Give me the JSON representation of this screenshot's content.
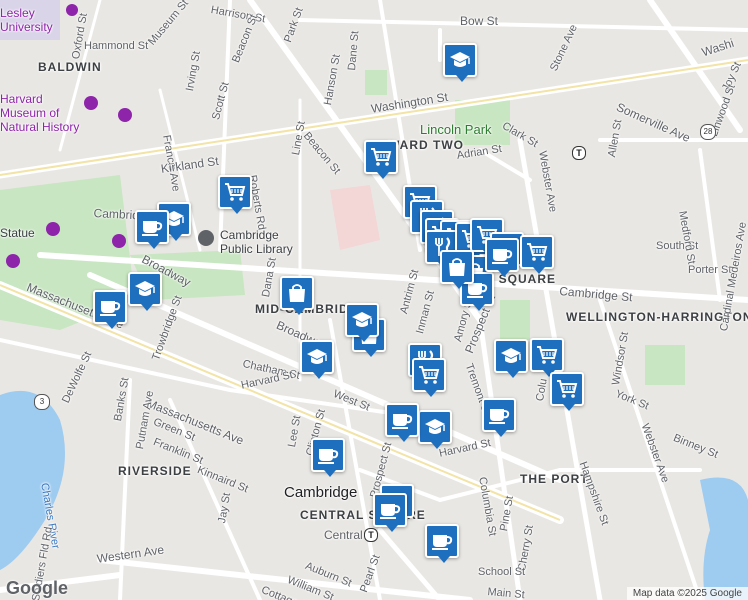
{
  "map": {
    "area_labels": [
      {
        "id": "baldwin",
        "text": "BALDWIN"
      },
      {
        "id": "ward-two",
        "text": "WARD TWO"
      },
      {
        "id": "mid-cambridge",
        "text": "MID-CAMBRIDGE"
      },
      {
        "id": "wellington-harrington",
        "text": "WELLINGTON-HARRINGTON"
      },
      {
        "id": "riverside",
        "text": "RIVERSIDE"
      },
      {
        "id": "the-port",
        "text": "THE PORT"
      },
      {
        "id": "central-square",
        "text": "CENTRAL SQUARE"
      },
      {
        "id": "inman-square",
        "text": "INMAN SQUARE"
      }
    ],
    "city_label": "Cambridge",
    "park_labels": [
      {
        "id": "lincoln-park",
        "text": "Lincoln Park"
      }
    ],
    "poi_labels": [
      {
        "id": "museum",
        "text": "Harvard Museum of Natural History"
      },
      {
        "id": "library",
        "text": "Cambridge Public Library"
      },
      {
        "id": "statue",
        "text": "Statue"
      },
      {
        "id": "university",
        "text": "Lesley University"
      }
    ],
    "water_labels": [
      {
        "id": "charles",
        "text": "Charles River"
      }
    ],
    "street_labels": [
      {
        "id": "bow",
        "text": "Bow St"
      },
      {
        "id": "washington-top",
        "text": "Washington St"
      },
      {
        "id": "washington-right",
        "text": "Washi"
      },
      {
        "id": "stone",
        "text": "Stone Ave"
      },
      {
        "id": "joy",
        "text": "Joy St"
      },
      {
        "id": "linwood",
        "text": "Linwood St"
      },
      {
        "id": "somerville",
        "text": "Somerville Ave"
      },
      {
        "id": "clark",
        "text": "Clark St"
      },
      {
        "id": "adrian",
        "text": "Adrian St"
      },
      {
        "id": "allen",
        "text": "Allen St"
      },
      {
        "id": "webster-top",
        "text": "Webster Ave"
      },
      {
        "id": "webster-bottom",
        "text": "Webster Ave"
      },
      {
        "id": "hammond",
        "text": "Hammond St"
      },
      {
        "id": "museum-st",
        "text": "Museum St"
      },
      {
        "id": "oxford",
        "text": "Oxford St"
      },
      {
        "id": "harrison",
        "text": "Harrison St"
      },
      {
        "id": "park",
        "text": "Park St"
      },
      {
        "id": "beacon-top",
        "text": "Beacon St"
      },
      {
        "id": "beacon-mid",
        "text": "Beacon St"
      },
      {
        "id": "dane",
        "text": "Dane St"
      },
      {
        "id": "hanson",
        "text": "Hanson St"
      },
      {
        "id": "irving",
        "text": "Irving St"
      },
      {
        "id": "scott",
        "text": "Scott St"
      },
      {
        "id": "francis",
        "text": "Francis Ave"
      },
      {
        "id": "kirkland",
        "text": "Kirkland St"
      },
      {
        "id": "line",
        "text": "Line St"
      },
      {
        "id": "roberts",
        "text": "Roberts Rd"
      },
      {
        "id": "cambridge-left",
        "text": "Cambridge St"
      },
      {
        "id": "cambridge-right",
        "text": "Cambridge St"
      },
      {
        "id": "south",
        "text": "South St"
      },
      {
        "id": "porter",
        "text": "Porter St"
      },
      {
        "id": "medford",
        "text": "Medford St"
      },
      {
        "id": "cardinal",
        "text": "Cardinal Medeiros Ave"
      },
      {
        "id": "broadway",
        "text": "Broadway"
      },
      {
        "id": "broadway-mid",
        "text": "Broadway"
      },
      {
        "id": "massachusetts-left",
        "text": "Massachusetts Ave"
      },
      {
        "id": "massachusetts-mid",
        "text": "Massachusetts Ave"
      },
      {
        "id": "dana",
        "text": "Dana St"
      },
      {
        "id": "antrim",
        "text": "Antrim St"
      },
      {
        "id": "inman",
        "text": "Inman St"
      },
      {
        "id": "amory",
        "text": "Amory St"
      },
      {
        "id": "prospect-top",
        "text": "Prospect St"
      },
      {
        "id": "prospect-bottom",
        "text": "Prospect St"
      },
      {
        "id": "chatham",
        "text": "Chatham St"
      },
      {
        "id": "harvard-left",
        "text": "Harvard St"
      },
      {
        "id": "harvard-right",
        "text": "Harvard St"
      },
      {
        "id": "west",
        "text": "West St"
      },
      {
        "id": "trowbridge",
        "text": "Trowbridge St"
      },
      {
        "id": "dewolfe",
        "text": "DeWolfe St"
      },
      {
        "id": "banks",
        "text": "Banks St"
      },
      {
        "id": "putnam",
        "text": "Putnam Ave"
      },
      {
        "id": "green",
        "text": "Green St"
      },
      {
        "id": "franklin",
        "text": "Franklin St"
      },
      {
        "id": "kinnaird",
        "text": "Kinnaird St"
      },
      {
        "id": "jay",
        "text": "Jay St"
      },
      {
        "id": "lee",
        "text": "Lee St"
      },
      {
        "id": "clinton",
        "text": "Clinton St"
      },
      {
        "id": "columbia",
        "text": "Columbia St"
      },
      {
        "id": "pine",
        "text": "Pine St"
      },
      {
        "id": "cherry",
        "text": "Cherry St"
      },
      {
        "id": "school",
        "text": "School St"
      },
      {
        "id": "main",
        "text": "Main St"
      },
      {
        "id": "western",
        "text": "Western Ave"
      },
      {
        "id": "auburn",
        "text": "Auburn St"
      },
      {
        "id": "william",
        "text": "William St"
      },
      {
        "id": "cottage",
        "text": "Cottage St"
      },
      {
        "id": "pearl",
        "text": "Pearl St"
      },
      {
        "id": "soldiers",
        "text": "Soldiers Fld Rd"
      },
      {
        "id": "york",
        "text": "York St"
      },
      {
        "id": "binney",
        "text": "Binney St"
      },
      {
        "id": "windsor",
        "text": "Windsor St"
      },
      {
        "id": "hampshire",
        "text": "Hampshire St"
      },
      {
        "id": "tremont",
        "text": "Tremont St"
      },
      {
        "id": "columbia-top",
        "text": "Colu"
      },
      {
        "id": "central-stop",
        "text": "Central"
      }
    ],
    "route_shields": [
      {
        "id": "r28",
        "text": "28"
      },
      {
        "id": "r3",
        "text": "3"
      }
    ],
    "markers": [
      {
        "id": "m1",
        "icon": "school"
      },
      {
        "id": "m2",
        "icon": "grocery"
      },
      {
        "id": "m3",
        "icon": "grocery"
      },
      {
        "id": "m4",
        "icon": "school"
      },
      {
        "id": "m5",
        "icon": "cafe"
      },
      {
        "id": "m6",
        "icon": "grocery"
      },
      {
        "id": "m7",
        "icon": "restaurant"
      },
      {
        "id": "m8",
        "icon": "restaurant"
      },
      {
        "id": "m9",
        "icon": "grocery"
      },
      {
        "id": "m10",
        "icon": "grocery"
      },
      {
        "id": "m11",
        "icon": "restaurant"
      },
      {
        "id": "m12",
        "icon": "grocery"
      },
      {
        "id": "m13",
        "icon": "grocery"
      },
      {
        "id": "m14",
        "icon": "shopping"
      },
      {
        "id": "m15",
        "icon": "cafe"
      },
      {
        "id": "m16",
        "icon": "school"
      },
      {
        "id": "m17",
        "icon": "cafe"
      },
      {
        "id": "m18",
        "icon": "shopping"
      },
      {
        "id": "m19",
        "icon": "grocery"
      },
      {
        "id": "m20",
        "icon": "shopping"
      },
      {
        "id": "m21",
        "icon": "shopping"
      },
      {
        "id": "m22",
        "icon": "school"
      },
      {
        "id": "m23",
        "icon": "school"
      },
      {
        "id": "m24",
        "icon": "restaurant"
      },
      {
        "id": "m25",
        "icon": "grocery"
      },
      {
        "id": "m26",
        "icon": "school"
      },
      {
        "id": "m27",
        "icon": "grocery"
      },
      {
        "id": "m28",
        "icon": "grocery"
      },
      {
        "id": "m29",
        "icon": "cafe"
      },
      {
        "id": "m30",
        "icon": "school"
      },
      {
        "id": "m31",
        "icon": "cafe"
      },
      {
        "id": "m32",
        "icon": "cafe"
      },
      {
        "id": "m33",
        "icon": "school"
      },
      {
        "id": "m34",
        "icon": "cafe"
      },
      {
        "id": "m35",
        "icon": "school"
      },
      {
        "id": "m36",
        "icon": "cafe"
      },
      {
        "id": "m37",
        "icon": "cafe"
      }
    ]
  },
  "branding": {
    "google": "Google",
    "attribution": "Map data ©2025 Google"
  },
  "colors": {
    "marker": "#1f6fbf",
    "park": "#c8e6c1",
    "water": "#9ecbf0",
    "road": "#ffffff",
    "land": "#e9e7e3"
  }
}
